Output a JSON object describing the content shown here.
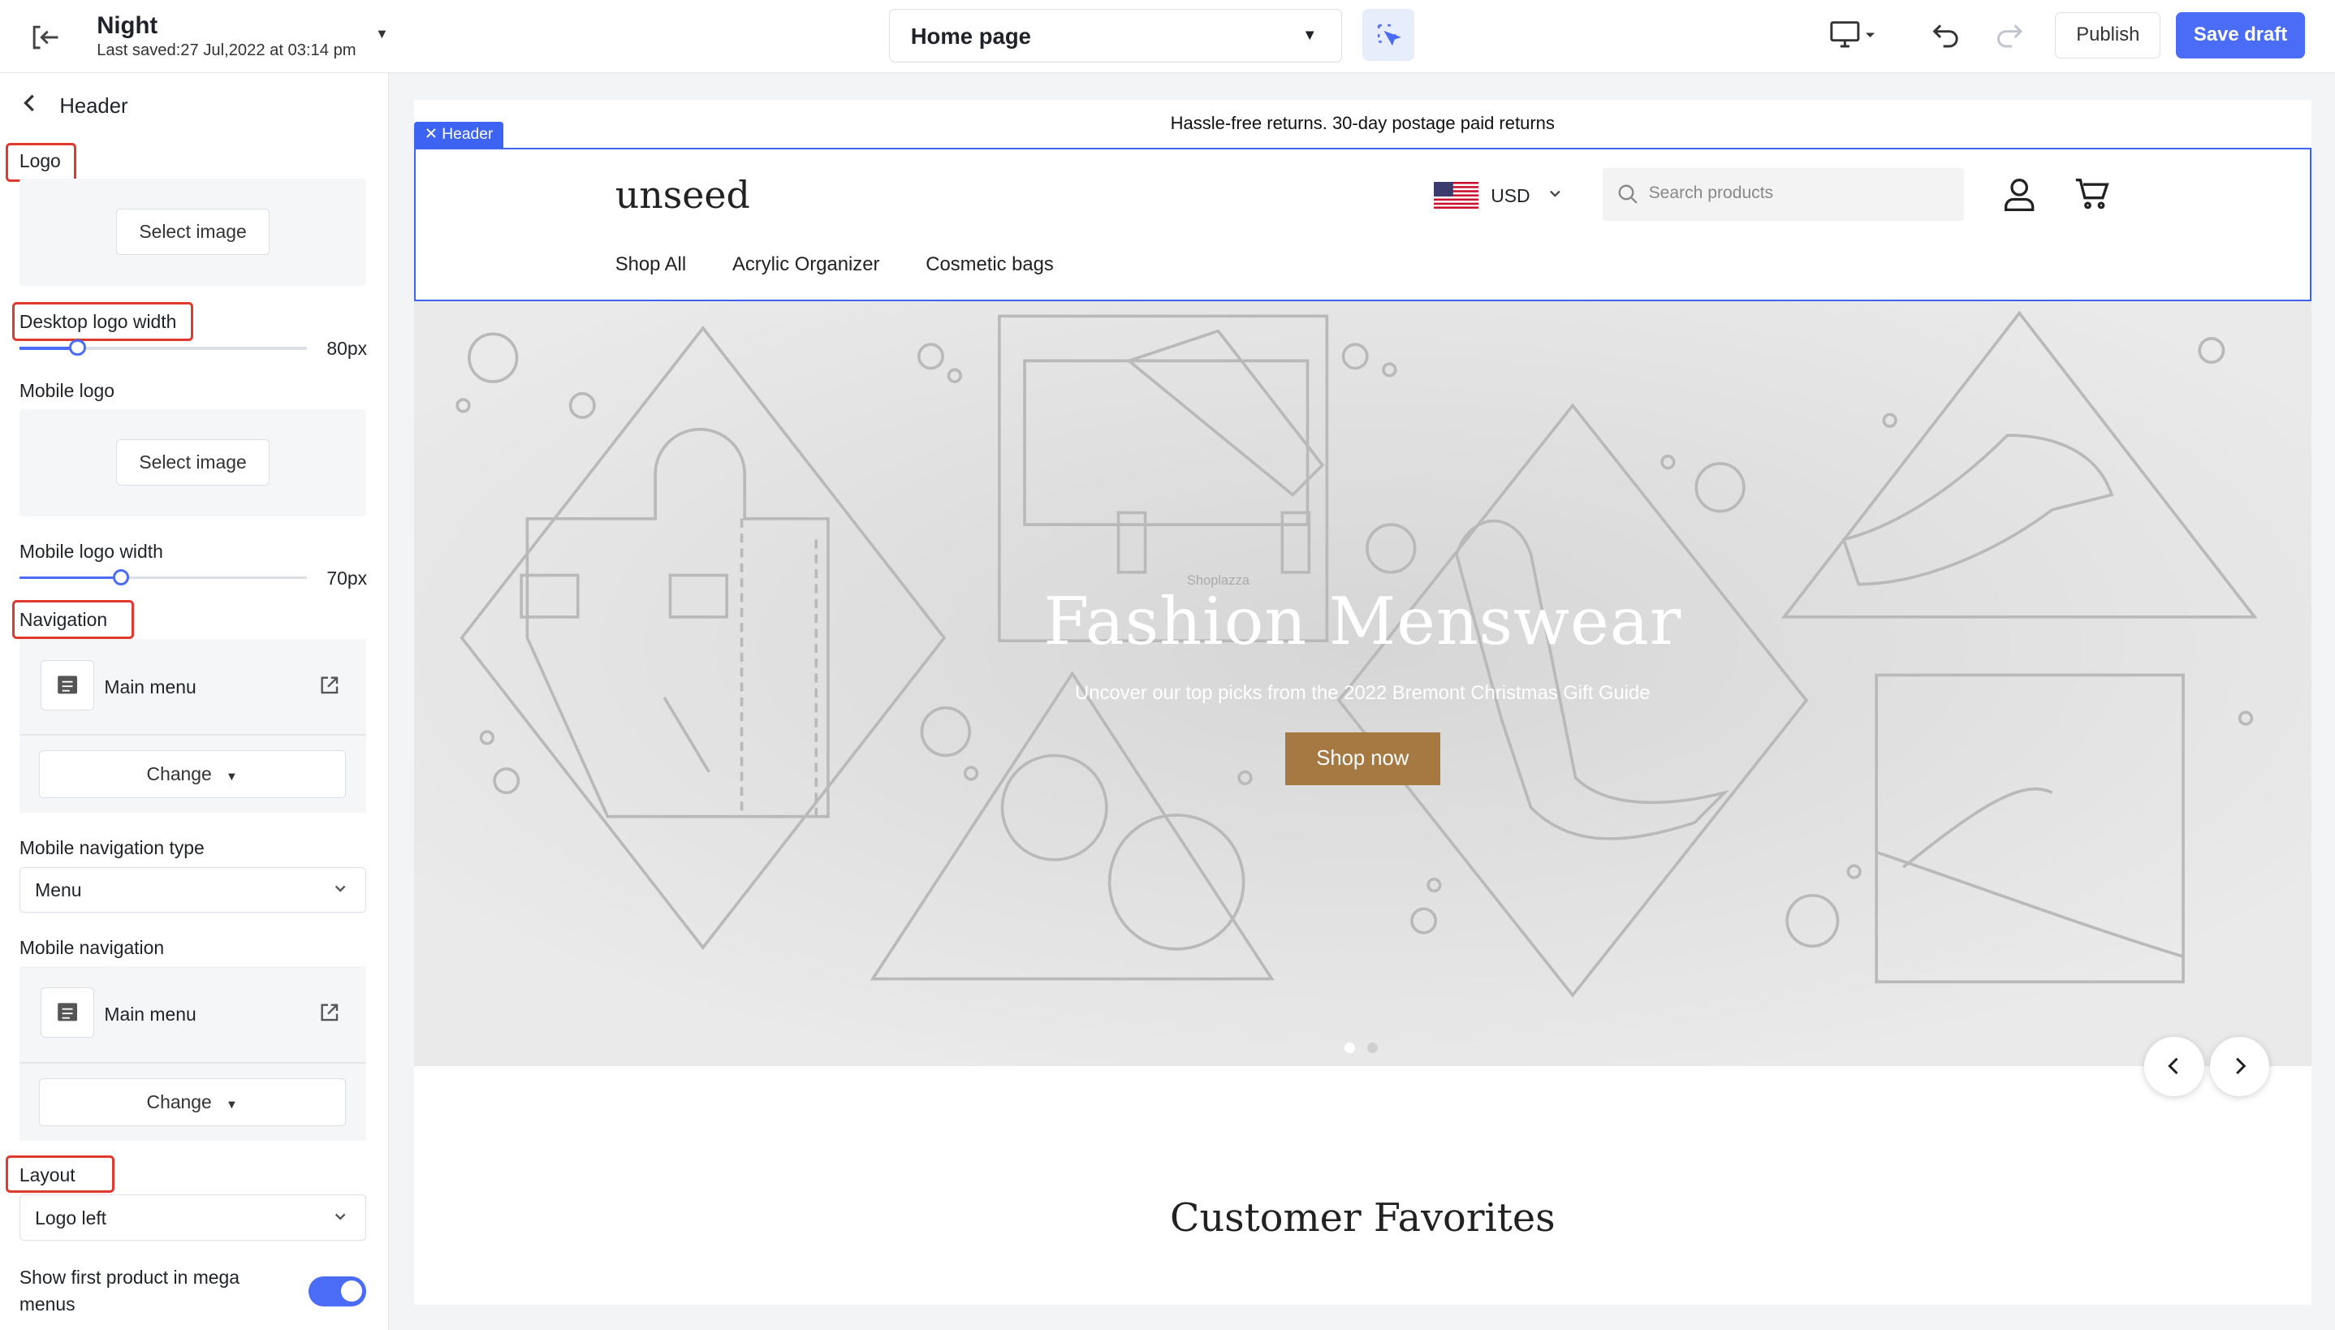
{
  "topbar": {
    "theme_name": "Night",
    "last_saved": "Last saved:27 Jul,2022 at 03:14 pm",
    "page_select": "Home page",
    "publish": "Publish",
    "save_draft": "Save draft"
  },
  "sidebar": {
    "title": "Header",
    "logo_label": "Logo",
    "select_image": "Select image",
    "desktop_logo_width_label": "Desktop logo width",
    "desktop_logo_width_value": "80px",
    "desktop_logo_width_fraction": 0.2,
    "mobile_logo_label": "Mobile logo",
    "mobile_select_image": "Select image",
    "mobile_logo_width_label": "Mobile logo width",
    "mobile_logo_width_value": "70px",
    "mobile_logo_width_fraction": 0.35,
    "navigation_label": "Navigation",
    "navigation_menu": "Main menu",
    "change": "Change",
    "mobile_nav_type_label": "Mobile navigation type",
    "mobile_nav_type_value": "Menu",
    "mobile_navigation_label": "Mobile navigation",
    "mobile_navigation_menu": "Main menu",
    "mobile_change": "Change",
    "layout_label": "Layout",
    "layout_value": "Logo left",
    "mega_menu_label_1": "Show first product in mega",
    "mega_menu_label_2": "menus",
    "mega_menu_enabled": true
  },
  "preview": {
    "announcement": "Hassle-free returns. 30-day postage paid returns",
    "header_tag": "Header",
    "logo": "unseed",
    "currency": "USD",
    "search_placeholder": "Search products",
    "nav": [
      "Shop All",
      "Acrylic Organizer",
      "Cosmetic bags"
    ],
    "watermark": "Shoplazza",
    "hero_title": "Fashion Menswear",
    "hero_subtitle": "Uncover our top picks from the 2022 Bremont Christmas Gift Guide",
    "hero_button": "Shop now",
    "section_title": "Customer Favorites"
  },
  "colors": {
    "accent": "#4a6cf7",
    "annotation": "#e03a2f",
    "hero_button": "#a67842"
  }
}
